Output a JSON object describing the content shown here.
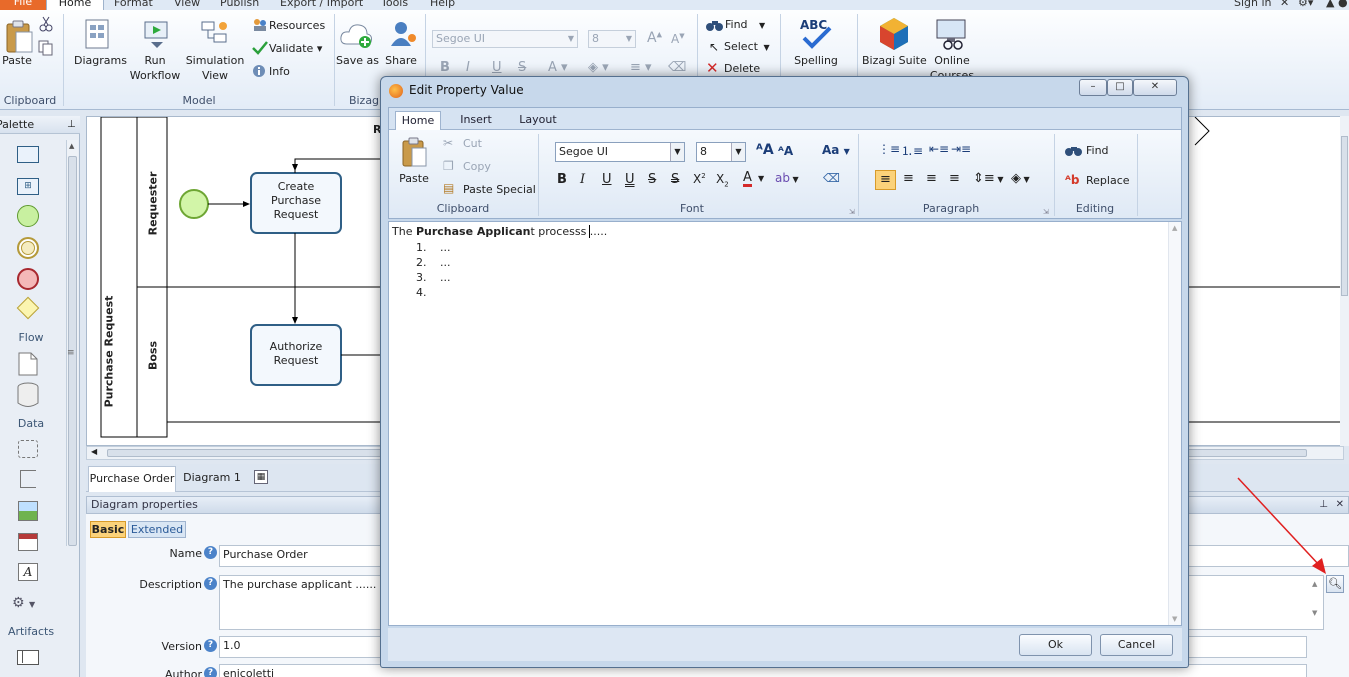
{
  "menu": {
    "file": "File",
    "tabs": [
      "Home",
      "Format",
      "View",
      "Publish",
      "Export / Import",
      "Tools",
      "Help"
    ],
    "sign_in": "Sign in"
  },
  "ribbon": {
    "clipboard": {
      "paste": "Paste",
      "group": "Clipboard"
    },
    "model": {
      "diagrams": "Diagrams",
      "run_workflow": [
        "Run",
        "Workflow"
      ],
      "simulation_view": [
        "Simulation",
        "View"
      ],
      "resources": "Resources",
      "validate": "Validate",
      "info": "Info",
      "group": "Model"
    },
    "bizagi": {
      "save_as": "Save as",
      "share": "Share",
      "group": "Bizag"
    },
    "font": {
      "name": "Segoe UI",
      "size": "8"
    },
    "editing": {
      "find": "Find",
      "select": "Select",
      "delete": "Delete"
    },
    "spelling": "Spelling",
    "bizagi_suite": "Bizagi Suite",
    "online_courses": [
      "Online",
      "Courses"
    ]
  },
  "palette": {
    "title": "Palette",
    "sections": {
      "flow": "Flow",
      "data": "Data",
      "artifacts": "Artifacts"
    }
  },
  "diagram": {
    "pool": "Purchase Request",
    "lanes": [
      "Requester",
      "Boss"
    ],
    "tasks": {
      "create": [
        "Create",
        "Purchase",
        "Request"
      ],
      "authorize": [
        "Authorize",
        "Request"
      ]
    },
    "partial_header": "R"
  },
  "bottom": {
    "tabs": [
      "Purchase Order",
      "Diagram 1"
    ],
    "props_title": "Diagram properties",
    "subtabs": {
      "basic": "Basic",
      "extended": "Extended"
    },
    "fields": {
      "name_label": "Name",
      "name_value": "Purchase Order",
      "description_label": "Description",
      "description_value": "The purchase applicant ......",
      "version_label": "Version",
      "version_value": "1.0",
      "author_label": "Author",
      "author_value": "enicoletti"
    }
  },
  "dialog": {
    "title": "Edit Property Value",
    "tabs": [
      "Home",
      "Insert",
      "Layout"
    ],
    "clipboard": {
      "paste": "Paste",
      "cut": "Cut",
      "copy": "Copy",
      "paste_special": "Paste Special",
      "group": "Clipboard"
    },
    "font": {
      "name": "Segoe UI",
      "size": "8",
      "group": "Font",
      "change_case": "Aa"
    },
    "paragraph": {
      "group": "Paragraph"
    },
    "editing": {
      "find": "Find",
      "replace": "Replace",
      "group": "Editing"
    },
    "editor": {
      "text_prefix": "The ",
      "text_bold": "Purchase Applican",
      "text_suffix": "t processs ",
      "text_tail": ".....",
      "list": [
        {
          "num": "1.",
          "text": "..."
        },
        {
          "num": "2.",
          "text": "..."
        },
        {
          "num": "3.",
          "text": "..."
        },
        {
          "num": "4.",
          "text": ""
        }
      ]
    },
    "ok": "Ok",
    "cancel": "Cancel"
  },
  "colors": {
    "accent": "#e86a2a",
    "task_border": "#2f5f86",
    "start_event": "#8cc63f",
    "annotation_arrow": "#e02020"
  }
}
